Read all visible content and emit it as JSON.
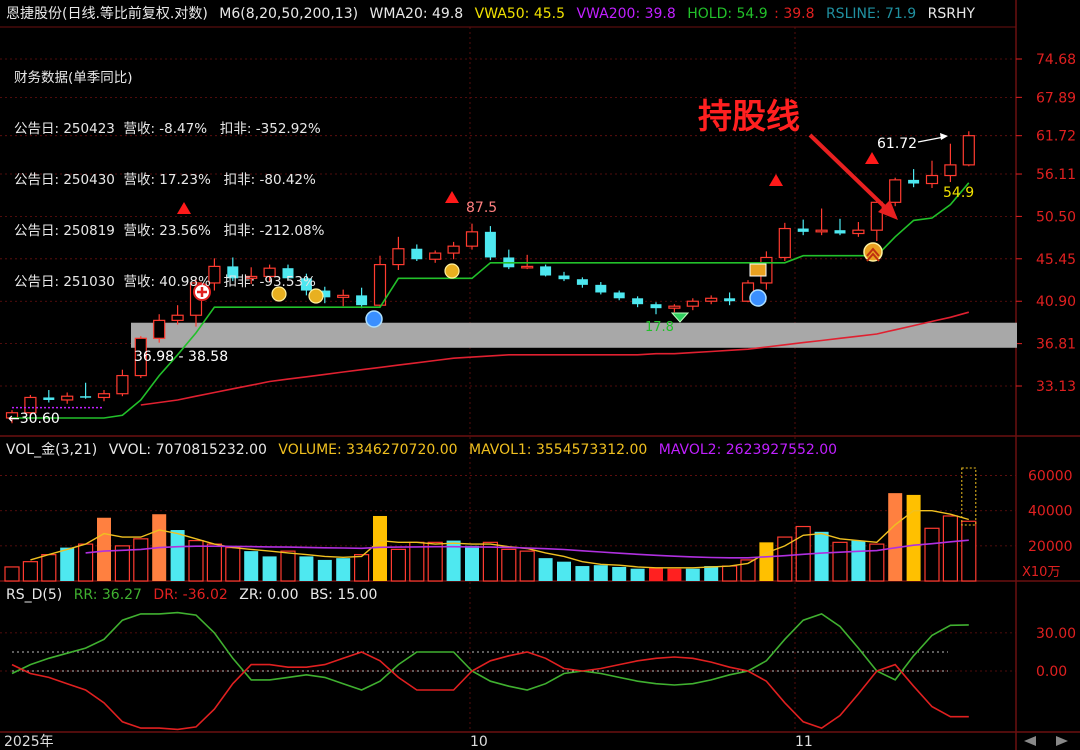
{
  "colors": {
    "up": "#ff3b30",
    "down": "#4ee8f0",
    "hold": "#22c02a",
    "wma": "#ffe000",
    "vwa50": "#f0e000",
    "vwa200": "#c020ff",
    "rsline": "#2090a0",
    "mavol1": "#f0c020",
    "mavol2": "#b030e0",
    "grid": "#6b1010",
    "rr": "#40b030",
    "dr": "#e02020",
    "volOrange": "#ff8040",
    "volYellow": "#ffc000",
    "volRed": "#ff2020"
  },
  "header": {
    "title": "恩捷股份(日线.等比前复权.对数)",
    "m6": "M6(8,20,50,200,13)",
    "wma20": "WMA20: 49.8",
    "vwa50": "VWA50: 45.5",
    "vwa200": "VWA200: 39.8",
    "hold_a": "HOLD: 54.9",
    "hold_b": ": 39.8",
    "rsline": "RSLINE: 71.9",
    "rsrhy": "RSRHY"
  },
  "financial": {
    "title": "财务数据(单季同比)",
    "rows": [
      "公告日: 250423  营收: -8.47%   扣非: -352.92%",
      "公告日: 250430  营收: 17.23%   扣非: -80.42%",
      "公告日: 250819  营收: 23.56%   扣非: -212.08%",
      "公告日: 251030  营收: 40.98%   扣非: -93.53%"
    ]
  },
  "annotation": {
    "text": "持股线"
  },
  "price_labels": {
    "high": "87.5",
    "last": "61.72",
    "hold": "54.9",
    "band": "36.98 - 38.58",
    "start": "←30.60",
    "low": "17.8"
  },
  "vol_header": {
    "name": "VOL_金(3,21)",
    "vvol": "VVOL: 7070815232.00",
    "volume": "VOLUME: 3346270720.00",
    "mavol1": "MAVOL1: 3554573312.00",
    "mavol2": "MAVOL2: 2623927552.00"
  },
  "rs_header": {
    "name": "RS_D(5)",
    "rr": "RR: 36.27",
    "dr": "DR: -36.02",
    "zr": "ZR: 0.00",
    "bs": "BS: 15.00"
  },
  "vol_unit": "X10万",
  "chart_data": [
    {
      "type": "candlestick",
      "ylabels": [
        "74.68",
        "67.89",
        "61.72",
        "56.11",
        "50.50",
        "45.45",
        "40.90",
        "36.81",
        "33.13"
      ],
      "xlabels": [
        "2025年",
        "10",
        "11"
      ],
      "candles": [
        [
          30.6,
          31.2,
          30.2,
          31.0
        ],
        [
          31.0,
          32.4,
          30.8,
          32.2
        ],
        [
          32.2,
          32.8,
          31.8,
          32.0
        ],
        [
          32.0,
          32.6,
          31.7,
          32.3
        ],
        [
          32.3,
          33.4,
          32.1,
          32.2
        ],
        [
          32.2,
          32.8,
          31.9,
          32.5
        ],
        [
          32.5,
          34.5,
          32.3,
          34.0
        ],
        [
          34.0,
          37.5,
          33.8,
          37.3
        ],
        [
          37.3,
          39.6,
          36.9,
          39.0
        ],
        [
          39.0,
          40.5,
          38.6,
          39.5
        ],
        [
          39.5,
          43.2,
          38.4,
          42.8
        ],
        [
          42.8,
          45.5,
          42.0,
          44.6
        ],
        [
          44.6,
          45.6,
          43.0,
          43.3
        ],
        [
          43.3,
          44.5,
          42.7,
          43.5
        ],
        [
          43.5,
          44.8,
          42.9,
          44.4
        ],
        [
          44.4,
          44.8,
          43.1,
          43.3
        ],
        [
          43.3,
          43.8,
          41.5,
          42.0
        ],
        [
          42.0,
          42.4,
          40.7,
          41.3
        ],
        [
          41.3,
          42.1,
          40.4,
          41.5
        ],
        [
          41.5,
          42.3,
          40.2,
          40.5
        ],
        [
          40.5,
          45.8,
          40.3,
          44.8
        ],
        [
          44.8,
          48.0,
          44.2,
          46.6
        ],
        [
          46.6,
          47.1,
          45.2,
          45.4
        ],
        [
          45.4,
          46.4,
          45.0,
          46.1
        ],
        [
          46.1,
          47.4,
          45.4,
          46.9
        ],
        [
          46.9,
          49.6,
          46.5,
          48.6
        ],
        [
          48.6,
          49.3,
          45.3,
          45.6
        ],
        [
          45.6,
          46.5,
          44.3,
          44.5
        ],
        [
          44.5,
          45.9,
          44.3,
          44.6
        ],
        [
          44.6,
          44.8,
          43.5,
          43.6
        ],
        [
          43.6,
          44.0,
          43.0,
          43.2
        ],
        [
          43.2,
          43.4,
          42.3,
          42.6
        ],
        [
          42.6,
          42.9,
          41.6,
          41.8
        ],
        [
          41.8,
          42.0,
          41.0,
          41.2
        ],
        [
          41.2,
          41.4,
          40.3,
          40.6
        ],
        [
          40.6,
          40.8,
          39.6,
          40.2
        ],
        [
          40.2,
          40.6,
          39.8,
          40.4
        ],
        [
          40.4,
          41.2,
          40.0,
          40.9
        ],
        [
          40.9,
          41.5,
          40.6,
          41.2
        ],
        [
          41.2,
          41.8,
          40.5,
          40.9
        ],
        [
          40.9,
          43.1,
          40.8,
          42.8
        ],
        [
          42.8,
          46.3,
          42.1,
          45.6
        ],
        [
          45.6,
          49.7,
          45.2,
          49.0
        ],
        [
          49.0,
          50.1,
          48.2,
          48.6
        ],
        [
          48.6,
          51.5,
          48.2,
          48.8
        ],
        [
          48.8,
          50.2,
          48.2,
          48.4
        ],
        [
          48.4,
          49.8,
          48.0,
          48.8
        ],
        [
          48.8,
          52.6,
          47.5,
          52.3
        ],
        [
          52.3,
          55.6,
          51.8,
          55.3
        ],
        [
          55.3,
          56.8,
          54.3,
          54.8
        ],
        [
          54.8,
          58.0,
          54.2,
          55.9
        ],
        [
          55.9,
          60.5,
          55.0,
          57.4
        ],
        [
          57.4,
          62.4,
          57.2,
          61.72
        ]
      ],
      "hold": [
        30.6,
        30.6,
        30.6,
        30.6,
        30.6,
        30.6,
        30.8,
        32.0,
        34.0,
        35.8,
        37.8,
        40.3,
        40.3,
        40.3,
        40.3,
        40.3,
        40.3,
        40.3,
        40.3,
        40.3,
        40.3,
        43.3,
        43.3,
        43.3,
        43.3,
        43.3,
        45.0,
        45.0,
        45.0,
        45.0,
        45.0,
        45.0,
        45.0,
        45.0,
        45.0,
        45.0,
        45.0,
        45.0,
        45.0,
        45.0,
        45.0,
        45.0,
        45.0,
        45.8,
        45.8,
        45.8,
        45.8,
        45.8,
        48.0,
        50.0,
        50.3,
        52.0,
        54.9
      ],
      "vwa200": [
        null,
        null,
        null,
        null,
        null,
        null,
        null,
        31.6,
        31.8,
        32.0,
        32.3,
        32.6,
        32.9,
        33.2,
        33.5,
        33.7,
        33.9,
        34.1,
        34.3,
        34.5,
        34.7,
        34.9,
        35.1,
        35.3,
        35.5,
        35.6,
        35.7,
        35.8,
        35.8,
        35.8,
        35.8,
        35.8,
        35.8,
        35.8,
        35.8,
        35.9,
        35.9,
        36.0,
        36.1,
        36.2,
        36.3,
        36.5,
        36.7,
        36.9,
        37.1,
        37.3,
        37.5,
        37.7,
        38.1,
        38.5,
        38.9,
        39.3,
        39.8
      ],
      "band": [
        36.98,
        38.58
      ]
    },
    {
      "type": "bar",
      "name": "VOL",
      "values": [
        8000,
        11000,
        15000,
        19000,
        21000,
        36000,
        20000,
        24000,
        38000,
        29000,
        23000,
        21000,
        19000,
        17000,
        14000,
        17000,
        14000,
        12000,
        13000,
        15000,
        37000,
        18000,
        22000,
        22000,
        23000,
        20000,
        22000,
        18000,
        17000,
        13000,
        11000,
        8500,
        9000,
        8000,
        7000,
        7500,
        7000,
        7000,
        8500,
        8500,
        12000,
        22000,
        25000,
        31000,
        28000,
        22000,
        23000,
        21000,
        50000,
        49000,
        30000,
        37000,
        34000
      ],
      "colors": [
        "r",
        "r",
        "r",
        "h",
        "r",
        "o",
        "r",
        "r",
        "o",
        "h",
        "r",
        "r",
        "r",
        "h",
        "h",
        "r",
        "h",
        "h",
        "h",
        "r",
        "y",
        "r",
        "r",
        "r",
        "h",
        "h",
        "r",
        "r",
        "r",
        "h",
        "h",
        "h",
        "h",
        "h",
        "h",
        "R",
        "R",
        "h",
        "h",
        "r",
        "r",
        "y",
        "r",
        "r",
        "h",
        "r",
        "h",
        "r",
        "o",
        "y",
        "r",
        "r",
        "r"
      ],
      "mavol1": [
        null,
        12000,
        15000,
        18000,
        21000,
        27000,
        25000,
        25000,
        29000,
        27000,
        24000,
        21000,
        19000,
        18000,
        17000,
        16000,
        15000,
        14000,
        13500,
        14000,
        23000,
        22000,
        22000,
        21000,
        21500,
        21000,
        21000,
        19500,
        18500,
        16000,
        14000,
        11000,
        9500,
        9000,
        8000,
        7500,
        7500,
        7500,
        8000,
        8500,
        10000,
        16000,
        20000,
        26000,
        27000,
        24000,
        23000,
        22000,
        32000,
        40000,
        40000,
        38000,
        35000
      ],
      "mavol2": [
        null,
        null,
        null,
        null,
        16000,
        17000,
        17500,
        18000,
        19000,
        19500,
        19800,
        19800,
        19700,
        19600,
        19400,
        19300,
        19100,
        18900,
        18800,
        18600,
        19200,
        19300,
        19400,
        19500,
        19500,
        19400,
        19300,
        19100,
        18800,
        18400,
        17900,
        17200,
        16500,
        15800,
        15200,
        14600,
        14100,
        13700,
        13400,
        13200,
        13200,
        13800,
        14400,
        15200,
        15900,
        16400,
        16900,
        17300,
        18900,
        20400,
        21200,
        22300,
        23200
      ],
      "ylabels": [
        "60000",
        "40000",
        "20000"
      ]
    },
    {
      "type": "line",
      "name": "RS_D(5)",
      "ylabels": [
        "30.00",
        "0.00"
      ],
      "rr": [
        -2,
        5,
        10,
        14,
        18,
        25,
        40,
        45,
        45,
        46,
        44,
        30,
        10,
        -7,
        -7,
        -5,
        -3,
        -5,
        -10,
        -15,
        -8,
        5,
        15,
        15,
        15,
        0,
        -8,
        -12,
        -15,
        -10,
        -2,
        0,
        -2,
        -5,
        -8,
        -10,
        -11,
        -10,
        -7,
        -3,
        0,
        8,
        25,
        40,
        45,
        35,
        18,
        0,
        -7,
        12,
        28,
        36,
        36.27
      ],
      "dr": [
        5,
        -2,
        -5,
        -10,
        -15,
        -25,
        -40,
        -45,
        -45,
        -46,
        -44,
        -30,
        -10,
        5,
        5,
        3,
        3,
        5,
        10,
        15,
        8,
        -5,
        -15,
        -15,
        -15,
        0,
        8,
        12,
        15,
        10,
        2,
        0,
        2,
        5,
        8,
        10,
        11,
        10,
        7,
        3,
        0,
        -8,
        -25,
        -40,
        -45,
        -35,
        -18,
        0,
        5,
        -12,
        -28,
        -36,
        -36.02
      ]
    }
  ]
}
